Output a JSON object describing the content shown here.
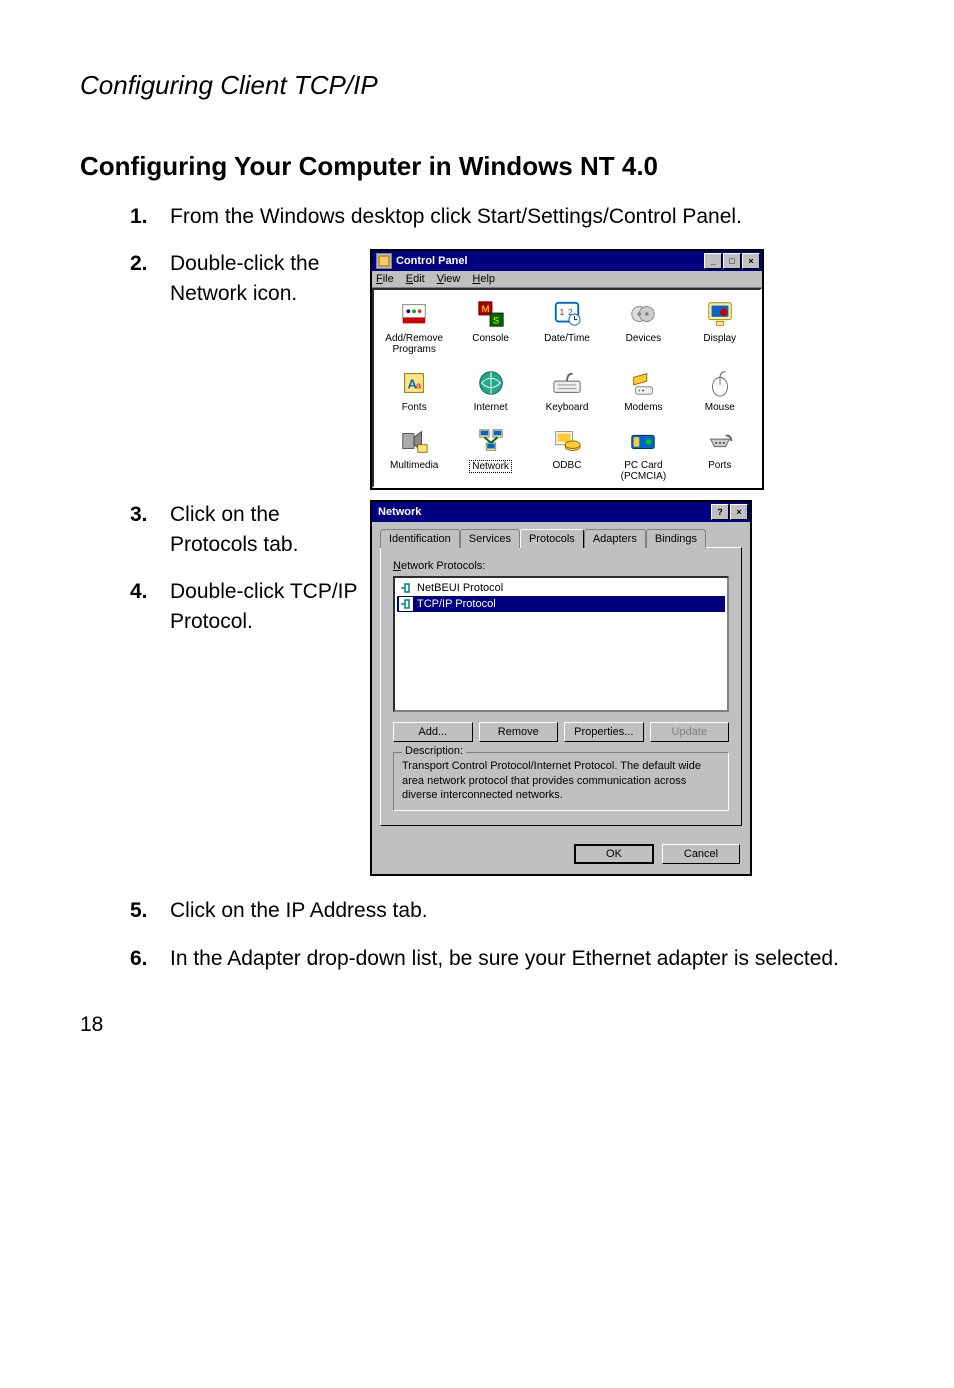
{
  "page": {
    "section_path": "Configuring Client TCP/IP",
    "heading": "Configuring Your Computer in Windows NT 4.0",
    "page_number": "18"
  },
  "steps": {
    "s1": {
      "num": "1.",
      "text": "From the Windows desktop click Start/Settings/Control Panel."
    },
    "s2": {
      "num": "2.",
      "text": "Double-click the Network icon."
    },
    "s3": {
      "num": "3.",
      "text": "Click on the Protocols tab."
    },
    "s4": {
      "num": "4.",
      "text": "Double-click TCP/IP Protocol."
    },
    "s5": {
      "num": "5.",
      "text": "Click on the IP Address tab."
    },
    "s6": {
      "num": "6.",
      "text": "In the Adapter drop-down list, be sure your Ethernet adapter is selected."
    }
  },
  "cp": {
    "title": "Control Panel",
    "menu": {
      "file": "File",
      "edit": "Edit",
      "view": "View",
      "help": "Help"
    },
    "icons": {
      "add_remove": "Add/Remove Programs",
      "console": "Console",
      "date_time": "Date/Time",
      "devices": "Devices",
      "display": "Display",
      "fonts": "Fonts",
      "internet": "Internet",
      "keyboard": "Keyboard",
      "modems": "Modems",
      "mouse": "Mouse",
      "multimedia": "Multimedia",
      "network": "Network",
      "odbc": "ODBC",
      "pc_card": "PC Card (PCMCIA)",
      "ports": "Ports"
    },
    "win_min": "_",
    "win_max": "□",
    "win_close": "×"
  },
  "net": {
    "title": "Network",
    "help": "?",
    "close": "×",
    "tabs": {
      "identification": "Identification",
      "services": "Services",
      "protocols": "Protocols",
      "adapters": "Adapters",
      "bindings": "Bindings"
    },
    "list_label": "Network Protocols:",
    "items": {
      "netbeui": "NetBEUI Protocol",
      "tcpip": "TCP/IP Protocol"
    },
    "buttons": {
      "add": "Add...",
      "remove": "Remove",
      "properties": "Properties...",
      "update": "Update"
    },
    "desc_title": "Description:",
    "desc_text": "Transport Control Protocol/Internet Protocol. The default wide area network protocol that provides communication across diverse interconnected networks.",
    "ok": "OK",
    "cancel": "Cancel"
  }
}
